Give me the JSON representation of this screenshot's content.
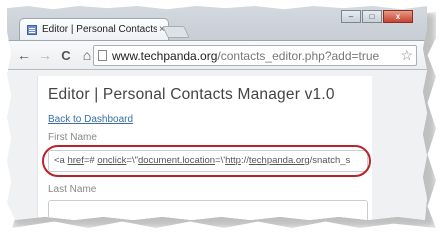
{
  "browser": {
    "tab_title": "Editor | Personal Contacts",
    "tab_close": "×",
    "url_host": "www.techpanda.org",
    "url_path": "/contacts_editor.php?add=true",
    "back": "←",
    "forward": "→",
    "reload": "C",
    "home": "⌂",
    "star": "☆",
    "win_min": "–",
    "win_max": "□",
    "win_close": "x"
  },
  "page": {
    "heading": "Editor | Personal Contacts Manager v1.0",
    "back_link": "Back to Dashboard",
    "fields": {
      "first_name_label": "First Name",
      "first_name_value_parts": [
        "<a ",
        "href",
        "=# ",
        "onclick",
        "=\\\"",
        "document.location",
        "=\\'",
        "http",
        "://",
        "techpanda.org",
        "/snatch_s"
      ],
      "last_name_label": "Last Name",
      "last_name_value": ""
    }
  },
  "colors": {
    "highlight": "#b8232b",
    "link": "#3a6ea5"
  }
}
